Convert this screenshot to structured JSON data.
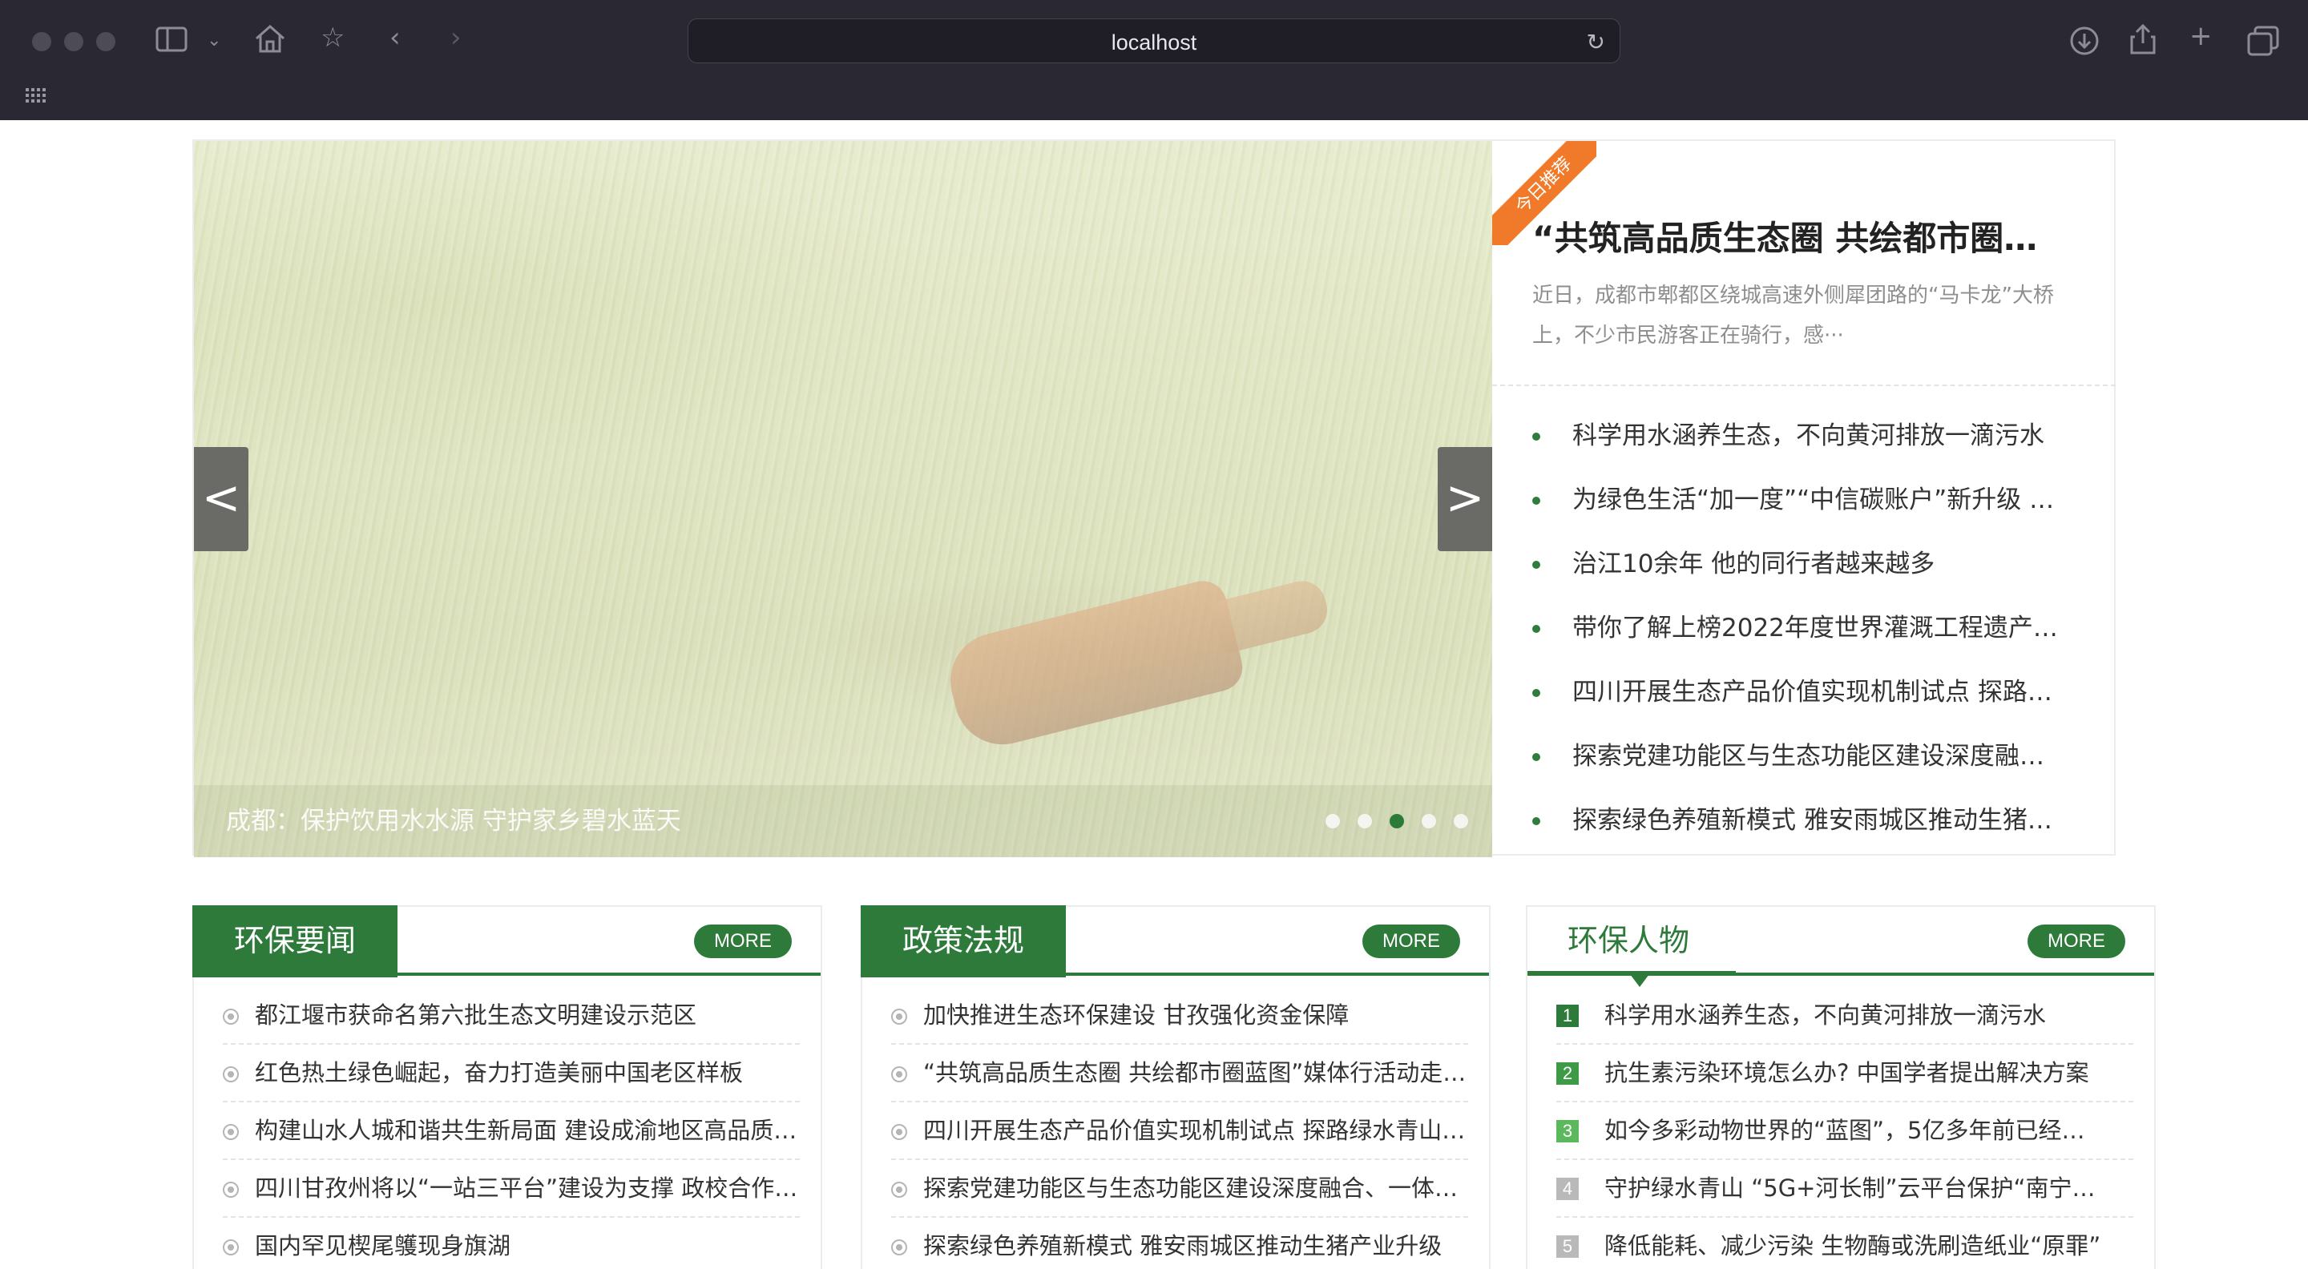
{
  "browser": {
    "url": "localhost",
    "icons": {
      "sidebar": "sidebar-icon",
      "home": "home-icon",
      "bookmark": "star-icon",
      "back": "chevron-left-icon",
      "forward": "chevron-right-icon",
      "reload": "reload-icon",
      "download": "download-icon",
      "share": "share-icon",
      "new_tab": "plus-icon",
      "tabs": "tab-overview-icon",
      "apps": "grid-icon"
    }
  },
  "carousel": {
    "caption": "成都：保护饮用水水源 守护家乡碧水蓝天",
    "prev_label": "<",
    "next_label": ">",
    "slide_count": 5,
    "active_index": 2
  },
  "featured": {
    "badge": "今日推荐",
    "title": "“共筑高品质生态圈 共绘都市圈…",
    "summary": "近日，成都市郫都区绕城高速外侧犀团路的“马卡龙”大桥上，不少市民游客正在骑行，感···",
    "list": [
      "科学用水涵养生态，不向黄河排放一滴污水",
      "为绿色生活“加一度”“中信碳账户”新升级 …",
      "治江10余年 他的同行者越来越多",
      "带你了解上榜2022年度世界灌溉工程遗产…",
      "四川开展生态产品价值实现机制试点 探路…",
      "探索党建功能区与生态功能区建设深度融…",
      "探索绿色养殖新模式 雅安雨城区推动生猪…"
    ]
  },
  "panels": {
    "news": {
      "title": "环保要闻",
      "more": "MORE",
      "items": [
        "都江堰市获命名第六批生态文明建设示范区",
        "红色热土绿色崛起，奋力打造美丽中国老区样板",
        "构建山水人城和谐共生新局面 建设成渝地区高品质…",
        "四川甘孜州将以“一站三平台”建设为支撑 政校合作…",
        "国内罕见楔尾鹱现身旗湖"
      ]
    },
    "policy": {
      "title": "政策法规",
      "more": "MORE",
      "items": [
        "加快推进生态环保建设 甘孜强化资金保障",
        "“共筑高品质生态圈 共绘都市圈蓝图”媒体行活动走…",
        "四川开展生态产品价值实现机制试点 探路绿水青山…",
        "探索党建功能区与生态功能区建设深度融合、一体…",
        "探索绿色养殖新模式 雅安雨城区推动生猪产业升级"
      ]
    },
    "people": {
      "title": "环保人物",
      "more": "MORE",
      "items": [
        {
          "rank": "1",
          "text": "科学用水涵养生态，不向黄河排放一滴污水",
          "color": "#2d7a3a"
        },
        {
          "rank": "2",
          "text": "抗生素污染环境怎么办? 中国学者提出解决方案",
          "color": "#3f9a48"
        },
        {
          "rank": "3",
          "text": "如今多彩动物世界的“蓝图”，5亿多年前已经…",
          "color": "#5cb85c"
        },
        {
          "rank": "4",
          "text": "守护绿水青山 “5G+河长制”云平台保护“南宁…",
          "color": "#b9b9b9"
        },
        {
          "rank": "5",
          "text": "降低能耗、减少污染 生物酶或洗刷造纸业“原罪”",
          "color": "#b9b9b9"
        }
      ]
    }
  }
}
